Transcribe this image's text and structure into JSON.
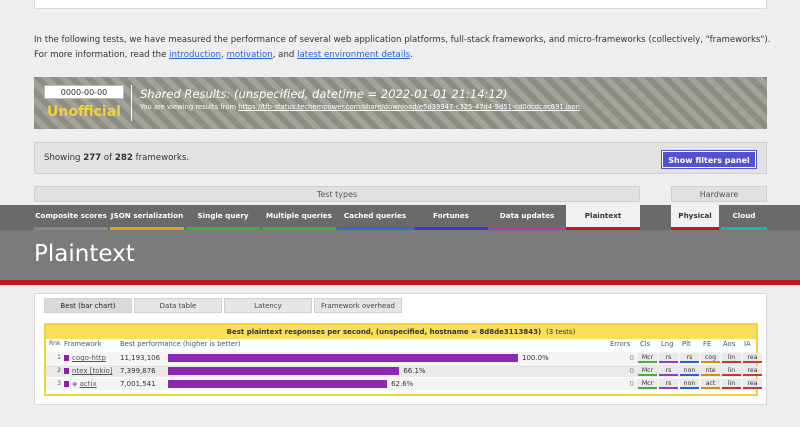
{
  "intro": {
    "line1": "In the following tests, we have measured the performance of several web application platforms, full-stack frameworks, and micro-frameworks (collectively, \"frameworks\").",
    "prefix": "For more information, read the ",
    "link_introduction": "introduction",
    "sep1": ", ",
    "link_motivation": "motivation",
    "sep2": ", and ",
    "link_env": "latest environment details",
    "suffix": "."
  },
  "banner": {
    "date": "0000-00-00",
    "status": "Unofficial",
    "title": "Shared Results: (unspecified, datetime = 2022-01-01 21:14:12)",
    "sub_prefix": "You are viewing results from ",
    "sub_link": "https://tfb-status.techempower.com/share/download/e5d39947-c325-47d4-9d51-cd0dcdcac691.json",
    "sub_suffix": "."
  },
  "filter_bar": {
    "showing_prefix": "Showing ",
    "shown": "277",
    "of": " of ",
    "total": "282",
    "suffix": " frameworks.",
    "button": "Show filters panel"
  },
  "headers": {
    "test_types": "Test types",
    "hardware": "Hardware"
  },
  "tabs": [
    {
      "label": "Composite scores",
      "color": "#888888"
    },
    {
      "label": "JSON serialization",
      "color": "#e8a21c"
    },
    {
      "label": "Single query",
      "color": "#36b336"
    },
    {
      "label": "Multiple queries",
      "color": "#36b336"
    },
    {
      "label": "Cached queries",
      "color": "#2c6fd0"
    },
    {
      "label": "Fortunes",
      "color": "#3c3cc8"
    },
    {
      "label": "Data updates",
      "color": "#b03cb0"
    },
    {
      "label": "Plaintext",
      "color": "#c01818"
    },
    {
      "label": "Physical",
      "color": "#c01818"
    },
    {
      "label": "Cloud",
      "color": "#2ab0b0"
    }
  ],
  "page_title": "Plaintext",
  "subtabs": [
    "Best (bar chart)",
    "Data table",
    "Latency",
    "Framework overhead"
  ],
  "table": {
    "heading": "Best plaintext responses per second, (unspecified, hostname = 8d8de3113843)",
    "count": "(3 tests)",
    "columns": [
      "Rnk",
      "Framework",
      "Best performance (higher is better)",
      "Errors",
      "Cls",
      "Lng",
      "Plt",
      "FE",
      "Aos",
      "IA"
    ],
    "rows": [
      {
        "rank": "1",
        "framework": "cogo-http",
        "value": "11,193,106",
        "fraction": 1.0,
        "percent": "100.0%",
        "errors": "0",
        "tags": [
          "Mcr",
          "rs",
          "rs",
          "cog",
          "lin",
          "rea"
        ]
      },
      {
        "rank": "2",
        "framework": "ntex [tokio]",
        "value": "7,399,876",
        "fraction": 0.661,
        "percent": "66.1%",
        "errors": "0",
        "tags": [
          "Mcr",
          "rs",
          "non",
          "nte",
          "lin",
          "rea"
        ]
      },
      {
        "rank": "3",
        "framework": "actix",
        "value": "7,001,541",
        "fraction": 0.626,
        "percent": "62.6%",
        "errors": "0",
        "tags": [
          "Mcr",
          "rs",
          "non",
          "act",
          "lin",
          "rea"
        ]
      }
    ]
  }
}
